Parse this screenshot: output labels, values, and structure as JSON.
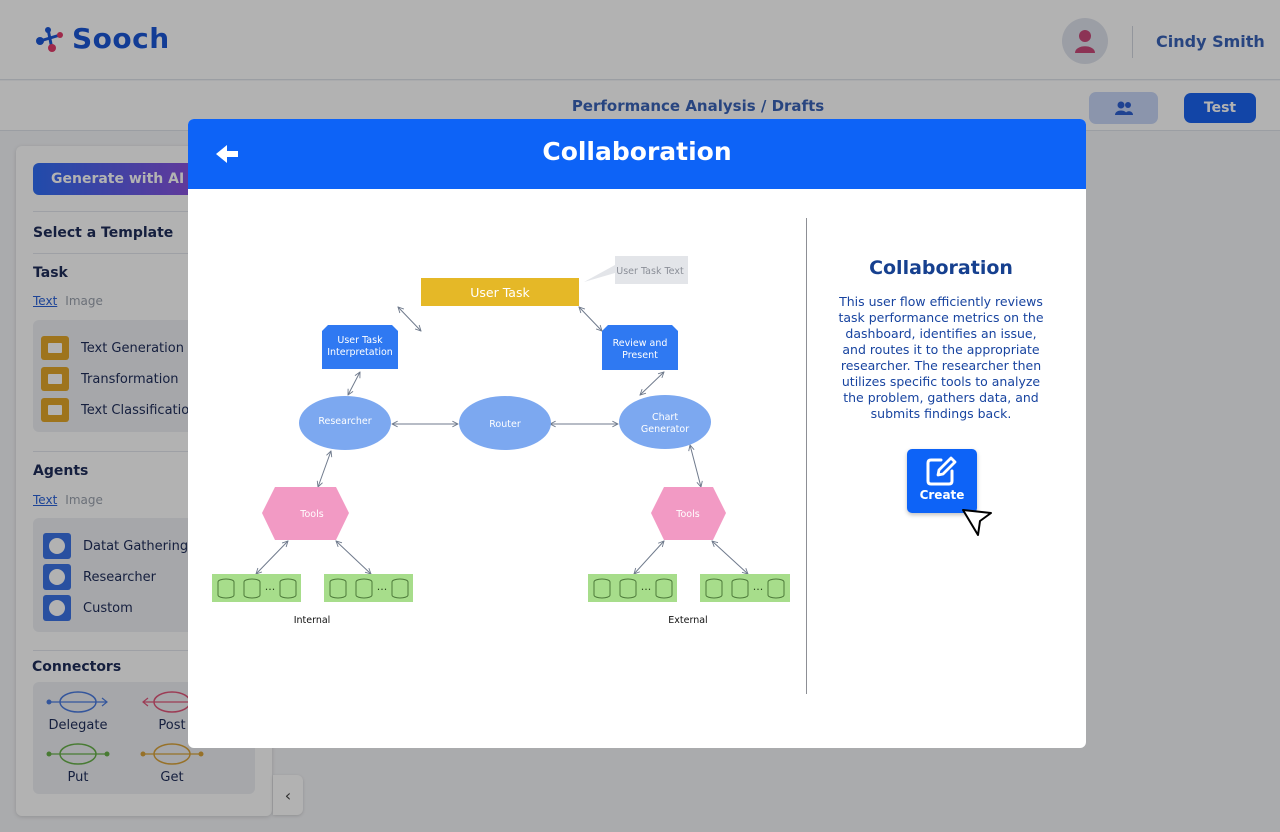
{
  "app": {
    "logo_text": "Sooch"
  },
  "header": {
    "user_name": "Cindy Smith"
  },
  "subheader": {
    "breadcrumb": "Performance Analysis / Drafts",
    "test_button": "Test"
  },
  "sidebar": {
    "generate_button": "Generate with AI Pr",
    "select_template": "Select a Template",
    "task_heading": "Task",
    "task_tabs": [
      "Text",
      "Image"
    ],
    "task_items": [
      "Text Generation",
      "Transformation",
      "Text Classification"
    ],
    "agents_heading": "Agents",
    "agent_tabs": [
      "Text",
      "Image"
    ],
    "agent_items": [
      "Datat Gathering",
      "Researcher",
      "Custom"
    ],
    "connectors_heading": "Connectors",
    "connectors": [
      "Delegate",
      "Post",
      "Put",
      "Get"
    ],
    "collapse_icon": "‹"
  },
  "modal": {
    "title": "Collaboration",
    "right_title": "Collaboration",
    "description": "This user flow efficiently reviews task performance metrics on the dashboard, identifies an issue, and routes it to the appropriate researcher. The researcher then utilizes specific tools to analyze the problem, gathers data, and submits findings back.",
    "create_label": "Create"
  },
  "diagram": {
    "user_task": "User Task",
    "user_task_text": "User Task Text",
    "interpretation": [
      "User Task",
      "Interpretation"
    ],
    "review": [
      "Review and",
      "Present"
    ],
    "researcher": "Researcher",
    "router": "Router",
    "chart_generator": [
      "Chart",
      "Generator"
    ],
    "tools": "Tools",
    "internal": "Internal",
    "external": "External",
    "ellipsis": "···"
  },
  "colors": {
    "primary": "#0d63f7",
    "user_task": "#e5b827",
    "node_blue": "#2f79f2",
    "ellipse": "#7ca8f0",
    "tools": "#f29ac4",
    "db": "#a7dd8b",
    "callout": "#e3e5e9"
  }
}
